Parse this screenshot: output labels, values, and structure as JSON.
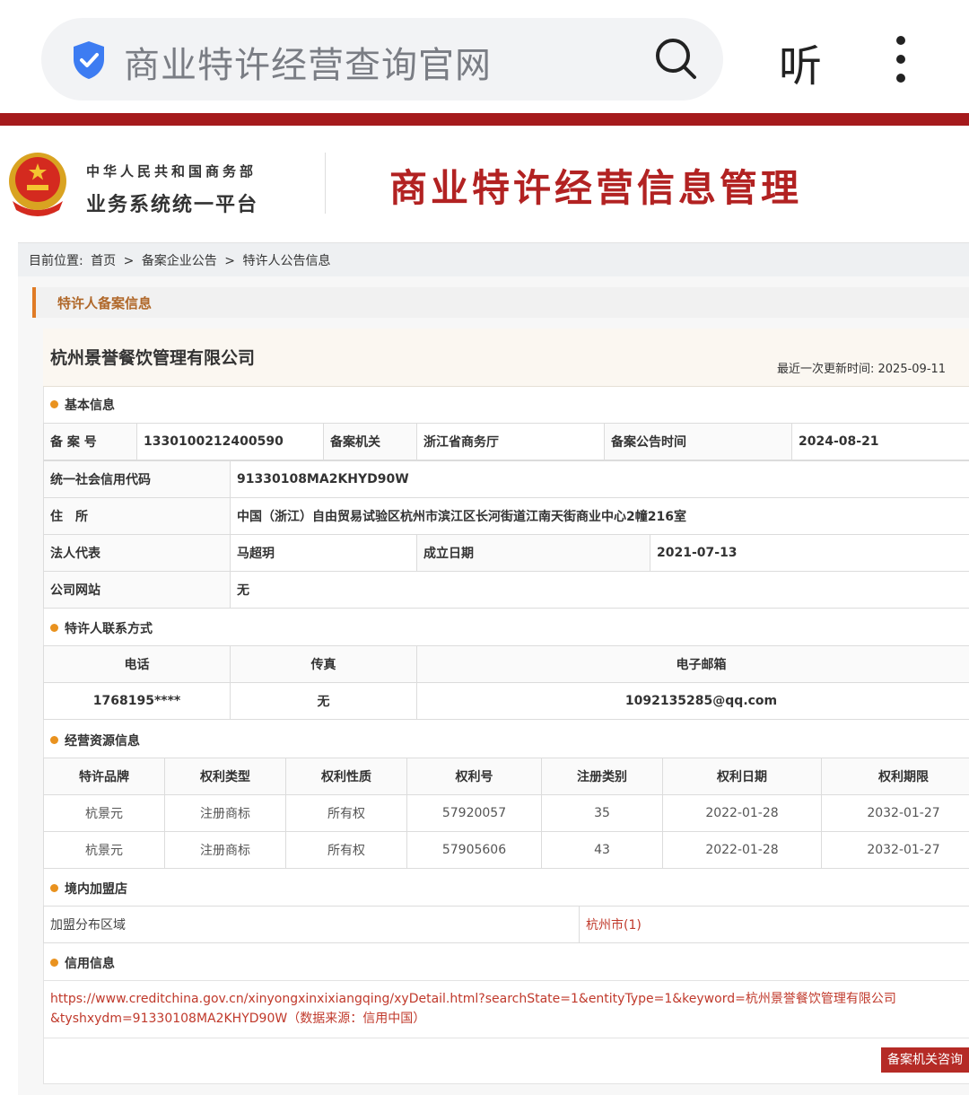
{
  "browser": {
    "search_text": "商业特许经营查询官网",
    "listen_label": "听"
  },
  "header": {
    "ministry": "中华人民共和国商务部",
    "platform": "业务系统统一平台",
    "title": "商业特许经营信息管理"
  },
  "breadcrumb": {
    "prefix": "目前位置:",
    "items": [
      "首页",
      ">",
      "备案企业公告",
      ">",
      "特许人公告信息"
    ]
  },
  "section_title": "特许人备案信息",
  "company": {
    "name": "杭州景誉餐饮管理有限公司",
    "updated": "最近一次更新时间:  2025-09-11"
  },
  "basic": {
    "heading": "基本信息",
    "record_no_label": "备 案 号",
    "record_no": "1330100212400590",
    "authority_label": "备案机关",
    "authority": "浙江省商务厅",
    "notice_time_label": "备案公告时间",
    "notice_time": "2024-08-21",
    "credit_code_label": "统一社会信用代码",
    "credit_code": "91330108MA2KHYD90W",
    "address_label": "住　所",
    "address": "中国（浙江）自由贸易试验区杭州市滨江区长河街道江南天街商业中心2幢216室",
    "legal_rep_label": "法人代表",
    "legal_rep": "马超玥",
    "founded_label": "成立日期",
    "founded": "2021-07-13",
    "website_label": "公司网站",
    "website": "无"
  },
  "contact": {
    "heading": "特许人联系方式",
    "phone_label": "电话",
    "fax_label": "传真",
    "email_label": "电子邮箱",
    "phone": "1768195****",
    "fax": "无",
    "email": "1092135285@qq.com"
  },
  "resources": {
    "heading": "经营资源信息",
    "columns": [
      "特许品牌",
      "权利类型",
      "权利性质",
      "权利号",
      "注册类别",
      "权利日期",
      "权利期限"
    ],
    "rows": [
      [
        "杭景元",
        "注册商标",
        "所有权",
        "57920057",
        "35",
        "2022-01-28",
        "2032-01-27"
      ],
      [
        "杭景元",
        "注册商标",
        "所有权",
        "57905606",
        "43",
        "2022-01-28",
        "2032-01-27"
      ]
    ]
  },
  "stores": {
    "heading": "境内加盟店",
    "region_label": "加盟分布区域",
    "region": "杭州市(1)"
  },
  "credit": {
    "heading": "信用信息",
    "link_line1": "https://www.creditchina.gov.cn/xinyongxinxixiangqing/xyDetail.html?searchState=1&entityType=1&keyword=杭州景誉餐饮管理有限公司",
    "link_line2": "&tyshxydm=91330108MA2KHYD90W（数据来源：信用中国）"
  },
  "consult_button": "备案机关咨询",
  "colors": {
    "brand_red": "#a51a1c",
    "title_red": "#b22222",
    "accent_orange": "#e07b25",
    "link_red": "#c0392b"
  }
}
